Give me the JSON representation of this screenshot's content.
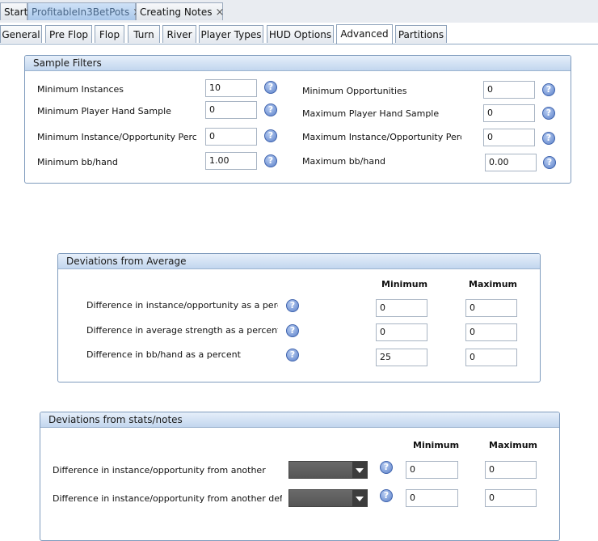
{
  "doc_tabs": [
    {
      "label": "Start"
    },
    {
      "label": "ProfitableIn3BetPots",
      "close": "×"
    },
    {
      "label": "Creating Notes",
      "close": "×"
    }
  ],
  "sub_tabs": [
    "General",
    "Pre Flop",
    "Flop",
    "Turn",
    "River",
    "Player Types",
    "HUD Options",
    "Advanced",
    "Partitions"
  ],
  "help_glyph": "?",
  "sample_filters": {
    "title": "Sample Filters",
    "left": [
      {
        "label": "Minimum Instances",
        "value": "10"
      },
      {
        "label": "Minimum Player Hand Sample",
        "value": "0"
      },
      {
        "label": "Minimum Instance/Opportunity Percer",
        "value": "0"
      },
      {
        "label": "Minimum bb/hand",
        "value": "1.00"
      }
    ],
    "right": [
      {
        "label": "Minimum Opportunities",
        "value": "0"
      },
      {
        "label": "Maximum Player Hand Sample",
        "value": "0"
      },
      {
        "label": "Maximum Instance/Opportunity Percer",
        "value": "0"
      },
      {
        "label": "Maximum bb/hand",
        "value": "0.00"
      }
    ]
  },
  "deviations_avg": {
    "title": "Deviations from Average",
    "min_header": "Minimum",
    "max_header": "Maximum",
    "rows": [
      {
        "label": "Difference in instance/opportunity as a percer",
        "min": "0",
        "max": "0"
      },
      {
        "label": "Difference in average strength as a percent",
        "min": "0",
        "max": "0"
      },
      {
        "label": "Difference in bb/hand as a percent",
        "min": "25",
        "max": "0"
      }
    ]
  },
  "deviations_stats": {
    "title": "Deviations from stats/notes",
    "min_header": "Minimum",
    "max_header": "Maximum",
    "rows": [
      {
        "label": "Difference in instance/opportunity from another sta",
        "min": "0",
        "max": "0"
      },
      {
        "label": "Difference in instance/opportunity from another defini",
        "min": "0",
        "max": "0"
      }
    ]
  },
  "colors": {
    "accent": "#7f9bbd",
    "active_tab": "#a9c7ea",
    "help_icon": "#5b80c9"
  }
}
